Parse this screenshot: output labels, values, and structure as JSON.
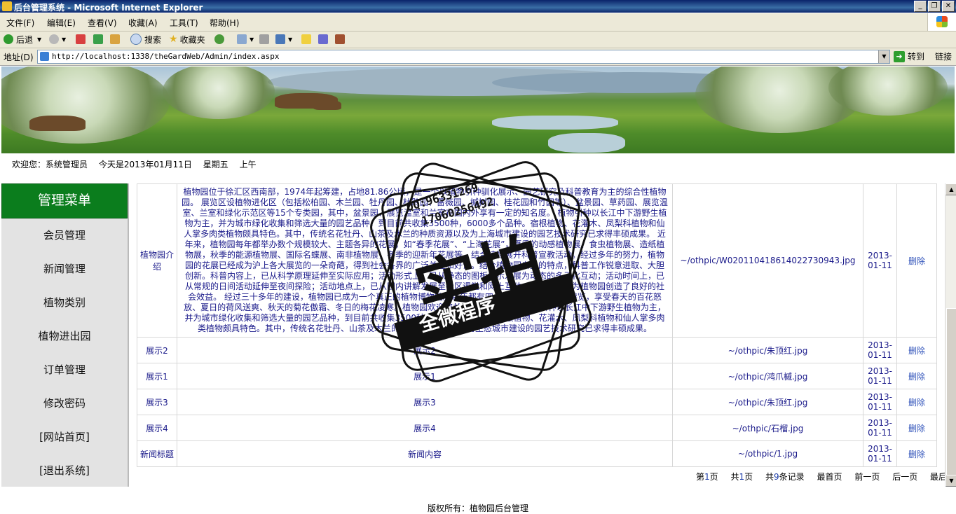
{
  "window": {
    "title": "后台管理系统 - Microsoft Internet Explorer"
  },
  "menubar": [
    "文件(F)",
    "编辑(E)",
    "查看(V)",
    "收藏(A)",
    "工具(T)",
    "帮助(H)"
  ],
  "toolbar": {
    "back": "后退",
    "search": "搜索",
    "favorites": "收藏夹"
  },
  "addressbar": {
    "label": "地址(D)",
    "url": "http://localhost:1338/theGardWeb/Admin/index.aspx",
    "go": "转到",
    "links": "链接"
  },
  "welcome": {
    "user": "欢迎您：系统管理员",
    "date": "今天是2013年01月11日",
    "weekday": "星期五",
    "period": "上午"
  },
  "sidebar": {
    "title": "管理菜单",
    "items": [
      "会员管理",
      "新闻管理",
      "植物类别",
      "植物进出园",
      "订单管理",
      "修改密码",
      "[网站首页]",
      "[退出系统]"
    ]
  },
  "table": {
    "delete_label": "删除",
    "rows": [
      {
        "title": "植物园介绍",
        "content": "植物园位于徐汇区西南部，1974年起筹建，占地81.86公顷，是一个以植物引种驯化展示、园艺研究及科普教育为主的综合性植物园。 展览区设植物进化区（包括松柏园、木兰园、牡丹园、杜鹃园、蔷薇园、槭树园、桂花园和竹园等）、盆景园、草药园、展览温室、兰室和绿化示范区等15个专类园，其中，盆景园、展览温室和兰室在国内外享有一定的知名度。 植物引种以长江中下游野生植物为主，并为城市绿化收集和筛选大量的园艺品种，到目前共收集3500种，6000多个品种。宿根植物、花灌木、凤梨科植物和仙人掌多肉类植物颇具特色。其中，传统名花牡丹、山茶及木兰的种质资源以及为上海城市建设的园艺技术研究已求得丰硕成果。 近年来，植物园每年都举办数个规模较大、主题各异的花展，如“春季花展”、“上海花展”，夏季的动感植物展、食虫植物展、造纸植物展，秋季的能源植物展、国际名蝶展、南非植物展，冬季的迎新年花展等，结合植物展开科普宣教活动。经过多年的努力，植物园的花展已经成为沪上各大展览的一朵奇葩，得到社会各界的广泛关注和好评。结合植物园自身的特点，科普工作锐意进取、大胆创新。科普内容上，已从科学原理延伸至实际应用；活动形式上，已从静态的图板展示发展为动态的多元化互动；活动时间上，已从常规的日间活动延伸至夜间探险；活动地点上，已从园内讲解发展至社区课堂和网上互动，使科普活动为植物园创造了良好的社会效益。 经过三十多年的建设，植物园已成为一个真正的植物博物馆。每年都有四十余万市民来园参观游览，享受春天的百花怒放、夏日的荷风送爽、秋天的菊花傲霜、冬日的梅花凌寒。植物园欢迎您并感谢您的光临。 植物引种以长江中下游野生植物为主，并为城市绿化收集和筛选大量的园艺品种，到目前共收集3500种，6000多个品种。宿根植物、花灌木、凤梨科植物和仙人掌多肉类植物颇具特色。其中，传统名花牡丹、山茶及木兰的种质资源以及为上海生态城市建设的园艺技术研究已求得丰硕成果。",
        "image": "~/othpic/W020110418614022730943.jpg",
        "date": "2013-01-11"
      },
      {
        "title": "展示2",
        "content": "展示2",
        "image": "~/othpic/朱顶红.jpg",
        "date": "2013-01-11"
      },
      {
        "title": "展示1",
        "content": "展示1",
        "image": "~/othpic/鸿爪槭.jpg",
        "date": "2013-01-11"
      },
      {
        "title": "展示3",
        "content": "展示3",
        "image": "~/othpic/朱顶红.jpg",
        "date": "2013-01-11"
      },
      {
        "title": "展示4",
        "content": "展示4",
        "image": "~/othpic/石榴.jpg",
        "date": "2013-01-11"
      },
      {
        "title": "新闻标题",
        "content": "新闻内容",
        "image": "~/othpic/1.jpg",
        "date": "2013-01-11"
      }
    ]
  },
  "pager": {
    "page_prefix": "第",
    "page_num": "1",
    "page_suffix": "页",
    "total_prefix": "共",
    "total_pages": "1",
    "total_suffix": "页",
    "records_prefix": "共",
    "records": "9",
    "records_suffix": "条记录",
    "first": "最首页",
    "prev": "前一页",
    "next": "后一页",
    "last": "最后页"
  },
  "footer": {
    "copyright": "版权所有：植物园后台管理"
  },
  "watermark": {
    "main": "实拍",
    "ribbon": "全微程序",
    "qq": "QQ:96331269",
    "phone": "17060256492"
  }
}
